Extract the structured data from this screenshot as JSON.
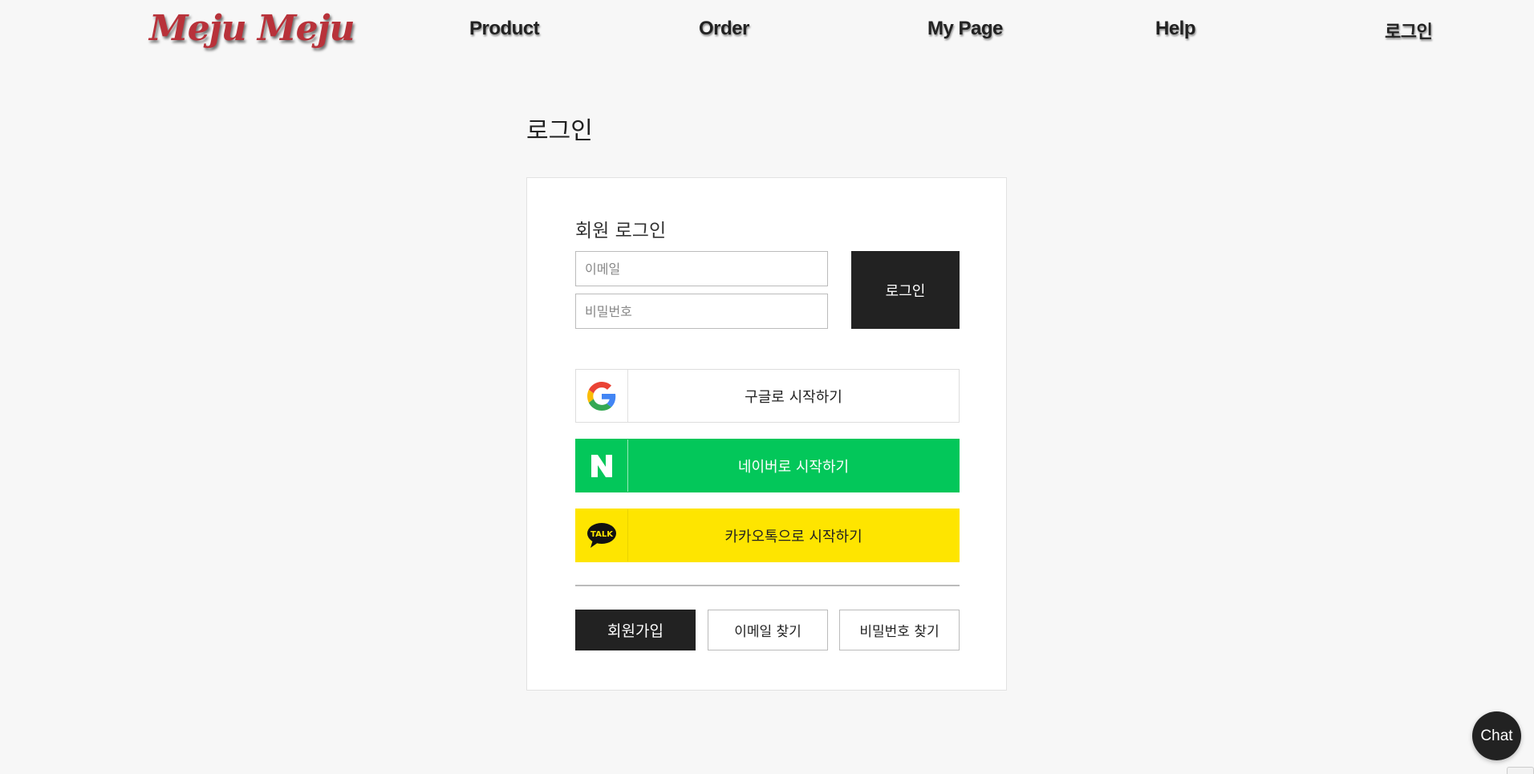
{
  "header": {
    "logo": "Meju Meju",
    "nav": {
      "product": "Product",
      "order": "Order",
      "mypage": "My Page",
      "help": "Help",
      "login": "로그인"
    }
  },
  "page": {
    "title": "로그인"
  },
  "login_form": {
    "section_title": "회원 로그인",
    "email_placeholder": "이메일",
    "password_placeholder": "비밀번호",
    "login_button": "로그인"
  },
  "social": {
    "google": {
      "label": "구글로 시작하기",
      "icon": "google-icon"
    },
    "naver": {
      "label": "네이버로 시작하기",
      "icon": "naver-icon",
      "icon_text": "N"
    },
    "kakao": {
      "label": "카카오톡으로 시작하기",
      "icon": "kakao-talk-icon",
      "icon_text": "TALK"
    }
  },
  "footer_actions": {
    "signup": "회원가입",
    "find_email": "이메일 찾기",
    "find_password": "비밀번호 찾기"
  },
  "chat": {
    "label": "Chat"
  },
  "colors": {
    "background": "#f7f7f7",
    "logo": "#b8323a",
    "dark": "#222222",
    "naver": "#03c75a",
    "kakao": "#fee500"
  }
}
